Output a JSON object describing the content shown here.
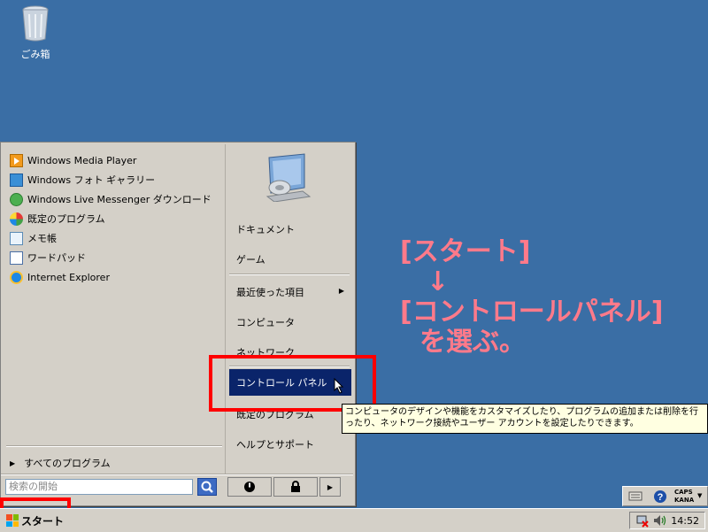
{
  "desktop": {
    "recycle_bin_label": "ごみ箱"
  },
  "annotation": {
    "line1": "[スタート]",
    "arrow": "↓",
    "line2": "[コントロールパネル]",
    "line3": "を選ぶ。"
  },
  "start_menu": {
    "pinned_programs": [
      {
        "label": "Windows Media Player",
        "icon": "media-player-icon"
      },
      {
        "label": "Windows フォト ギャラリー",
        "icon": "photo-gallery-icon"
      },
      {
        "label": "Windows Live Messenger ダウンロード",
        "icon": "messenger-icon"
      },
      {
        "label": "既定のプログラム",
        "icon": "default-programs-icon"
      },
      {
        "label": "メモ帳",
        "icon": "notepad-icon"
      },
      {
        "label": "ワードパッド",
        "icon": "wordpad-icon"
      },
      {
        "label": "Internet Explorer",
        "icon": "internet-explorer-icon"
      }
    ],
    "all_programs_label": "すべてのプログラム",
    "search_placeholder": "検索の開始",
    "right_items": {
      "documents": "ドキュメント",
      "games": "ゲーム",
      "recent": "最近使った項目",
      "computer": "コンピュータ",
      "network": "ネットワーク",
      "control_panel": "コントロール パネル",
      "default_programs": "既定のプログラム",
      "help": "ヘルプとサポート"
    },
    "tooltip": "コンピュータのデザインや機能をカスタマイズしたり、プログラムの追加または削除を行ったり、ネットワーク接続やユーザー アカウントを設定したりできます。"
  },
  "taskbar": {
    "start_label": "スタート",
    "clock": "14:52",
    "caps_label": "CAPS",
    "kana_label": "KANA"
  }
}
